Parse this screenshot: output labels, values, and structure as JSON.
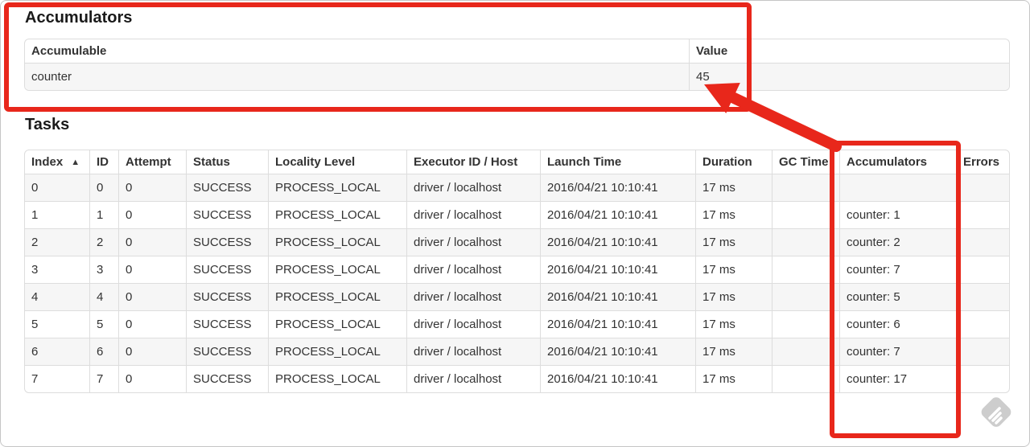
{
  "colors": {
    "annotation_red": "#e8271b",
    "table_border": "#dddddd",
    "row_stripe": "#f6f6f6",
    "text": "#333333",
    "watermark_gray": "#cdcdcd"
  },
  "icons": {
    "sort_asc": "▲"
  },
  "accumulators_section": {
    "title": "Accumulators",
    "table": {
      "headers": {
        "accumulable": "Accumulable",
        "value": "Value"
      },
      "rows": [
        {
          "accumulable": "counter",
          "value": "45"
        }
      ]
    }
  },
  "tasks_section": {
    "title": "Tasks",
    "table": {
      "headers": {
        "index": "Index",
        "id": "ID",
        "attempt": "Attempt",
        "status": "Status",
        "locality_level": "Locality Level",
        "executor_id_host": "Executor ID / Host",
        "launch_time": "Launch Time",
        "duration": "Duration",
        "gc_time": "GC Time",
        "accumulators": "Accumulators",
        "errors": "Errors"
      },
      "rows": [
        {
          "index": "0",
          "id": "0",
          "attempt": "0",
          "status": "SUCCESS",
          "locality_level": "PROCESS_LOCAL",
          "executor_id_host": "driver / localhost",
          "launch_time": "2016/04/21 10:10:41",
          "duration": "17 ms",
          "gc_time": "",
          "accumulators": "",
          "errors": ""
        },
        {
          "index": "1",
          "id": "1",
          "attempt": "0",
          "status": "SUCCESS",
          "locality_level": "PROCESS_LOCAL",
          "executor_id_host": "driver / localhost",
          "launch_time": "2016/04/21 10:10:41",
          "duration": "17 ms",
          "gc_time": "",
          "accumulators": "counter: 1",
          "errors": ""
        },
        {
          "index": "2",
          "id": "2",
          "attempt": "0",
          "status": "SUCCESS",
          "locality_level": "PROCESS_LOCAL",
          "executor_id_host": "driver / localhost",
          "launch_time": "2016/04/21 10:10:41",
          "duration": "17 ms",
          "gc_time": "",
          "accumulators": "counter: 2",
          "errors": ""
        },
        {
          "index": "3",
          "id": "3",
          "attempt": "0",
          "status": "SUCCESS",
          "locality_level": "PROCESS_LOCAL",
          "executor_id_host": "driver / localhost",
          "launch_time": "2016/04/21 10:10:41",
          "duration": "17 ms",
          "gc_time": "",
          "accumulators": "counter: 7",
          "errors": ""
        },
        {
          "index": "4",
          "id": "4",
          "attempt": "0",
          "status": "SUCCESS",
          "locality_level": "PROCESS_LOCAL",
          "executor_id_host": "driver / localhost",
          "launch_time": "2016/04/21 10:10:41",
          "duration": "17 ms",
          "gc_time": "",
          "accumulators": "counter: 5",
          "errors": ""
        },
        {
          "index": "5",
          "id": "5",
          "attempt": "0",
          "status": "SUCCESS",
          "locality_level": "PROCESS_LOCAL",
          "executor_id_host": "driver / localhost",
          "launch_time": "2016/04/21 10:10:41",
          "duration": "17 ms",
          "gc_time": "",
          "accumulators": "counter: 6",
          "errors": ""
        },
        {
          "index": "6",
          "id": "6",
          "attempt": "0",
          "status": "SUCCESS",
          "locality_level": "PROCESS_LOCAL",
          "executor_id_host": "driver / localhost",
          "launch_time": "2016/04/21 10:10:41",
          "duration": "17 ms",
          "gc_time": "",
          "accumulators": "counter: 7",
          "errors": ""
        },
        {
          "index": "7",
          "id": "7",
          "attempt": "0",
          "status": "SUCCESS",
          "locality_level": "PROCESS_LOCAL",
          "executor_id_host": "driver / localhost",
          "launch_time": "2016/04/21 10:10:41",
          "duration": "17 ms",
          "gc_time": "",
          "accumulators": "counter: 17",
          "errors": ""
        }
      ]
    }
  }
}
